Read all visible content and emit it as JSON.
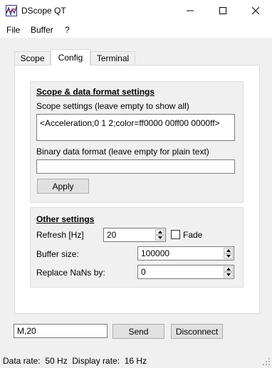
{
  "window": {
    "title": "DScope QT",
    "icons": {
      "app": "oscilloscope-icon",
      "minimize": "minimize-icon",
      "maximize": "maximize-icon",
      "close": "close-icon"
    }
  },
  "menu": {
    "file": "File",
    "buffer": "Buffer",
    "help": "?"
  },
  "tabs": [
    {
      "label": "Scope"
    },
    {
      "label": "Config",
      "active": true
    },
    {
      "label": "Terminal"
    }
  ],
  "scope_group": {
    "title": "Scope & data format settings",
    "scope_settings_label": "Scope settings (leave empty to show all)",
    "scope_settings_value": "<Acceleration;0 1 2;color=ff0000 00ff00 0000ff>",
    "binary_label": "Binary data format (leave empty for plain text)",
    "binary_value": "",
    "apply": "Apply"
  },
  "other_group": {
    "title": "Other settings",
    "refresh_label": "Refresh [Hz]",
    "refresh_value": "20",
    "fade_label": "Fade",
    "fade_checked": false,
    "buffer_label": "Buffer size:",
    "buffer_value": "100000",
    "nan_label": "Replace NaNs by:",
    "nan_value": "0"
  },
  "bottom": {
    "command_value": "M,20",
    "send": "Send",
    "disconnect": "Disconnect"
  },
  "status": {
    "text": "Data rate:  50 Hz  Display rate:  16 Hz"
  },
  "colors": {
    "titlebar": "#ffffff",
    "window": "#f0f0f0",
    "panel": "#ffffff"
  }
}
